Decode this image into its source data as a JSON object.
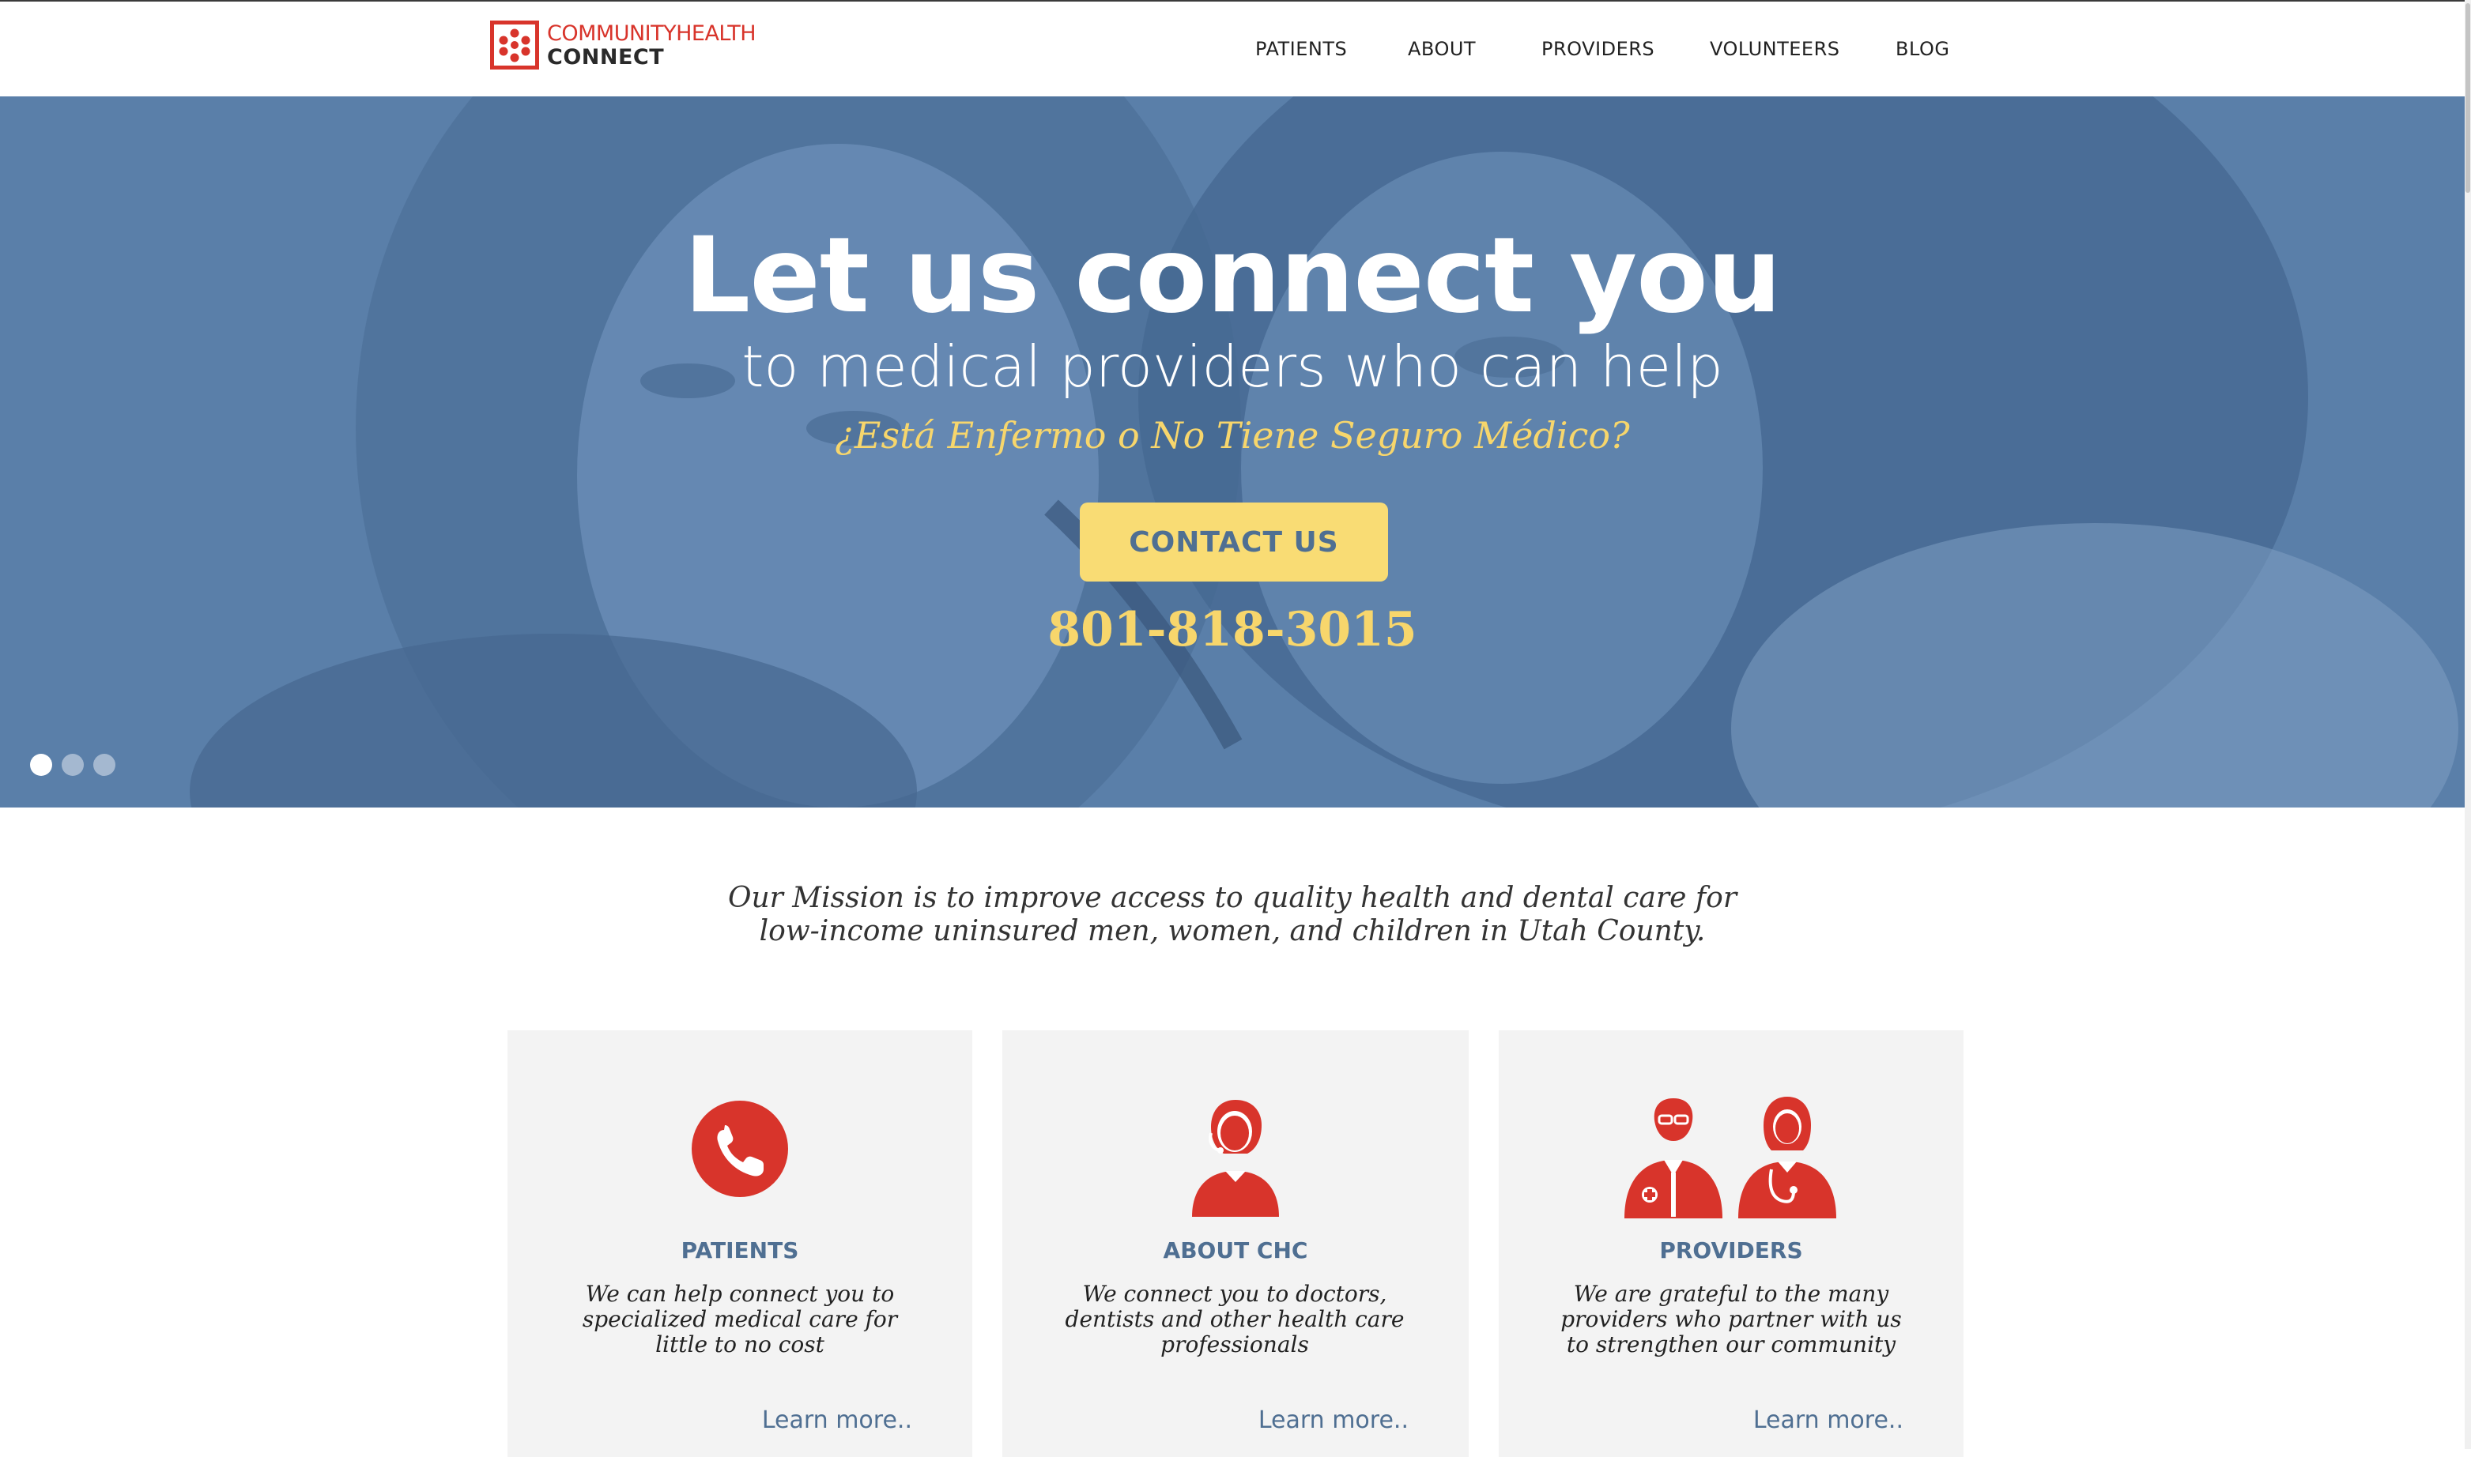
{
  "logo": {
    "line1": "COMMUNITYHEALTH",
    "line2": "CONNECT"
  },
  "nav": {
    "items": [
      {
        "label": "PATIENTS"
      },
      {
        "label": "ABOUT"
      },
      {
        "label": "PROVIDERS"
      },
      {
        "label": "VOLUNTEERS"
      },
      {
        "label": "BLOG"
      }
    ]
  },
  "hero": {
    "title": "Let us connect you",
    "subtitle": "to medical providers who can help",
    "spanish": "¿Está Enfermo o No Tiene Seguro Médico?",
    "cta_label": "CONTACT US",
    "phone": "801-818-3015",
    "slides": {
      "count": 3,
      "active": 1
    }
  },
  "mission": {
    "line1": "Our Mission is to improve access to quality health and dental care for",
    "line2": "low-income uninsured men, women, and children in Utah County."
  },
  "cards": [
    {
      "icon": "phone-icon",
      "title": "PATIENTS",
      "text": "We can help connect you to specialized medical care for little to no cost",
      "link": "Learn more.."
    },
    {
      "icon": "receptionist-icon",
      "title": "ABOUT CHC",
      "text": "We connect you to doctors, dentists and other health care professionals",
      "link": "Learn more.."
    },
    {
      "icon": "doctors-icon",
      "title": "PROVIDERS",
      "text": "We are grateful to the many providers who partner with us to strengthen our community",
      "link": "Learn more.."
    }
  ],
  "colors": {
    "brand_red": "#d8342b",
    "hero_blue": "#5a7fa8",
    "accent_yellow": "#f9dc74",
    "heading_blue": "#4f6f92",
    "card_bg": "#f3f3f3"
  }
}
